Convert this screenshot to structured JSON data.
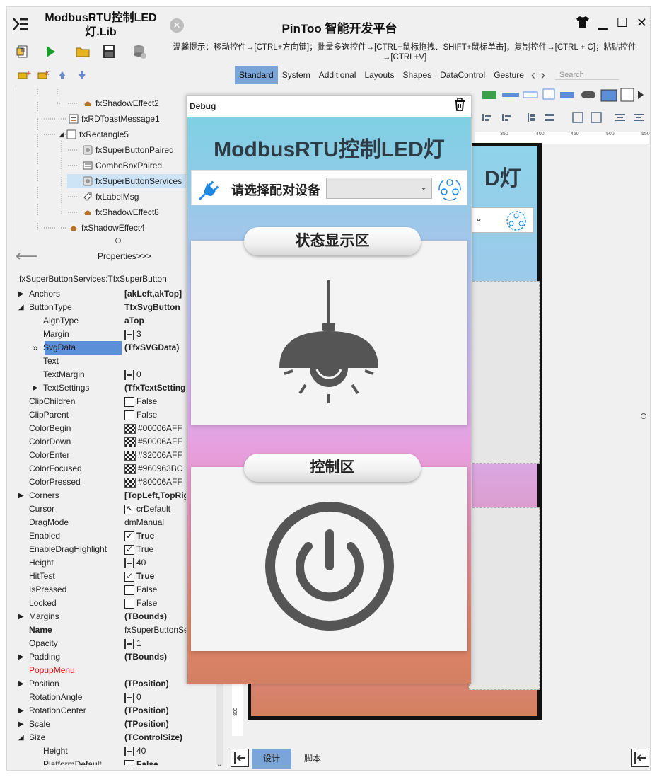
{
  "titlebar": {
    "doc_title": "ModbusRTU控制LED灯.Lib",
    "app_title": "PinToo 智能开发平台",
    "close_doc": "✕",
    "menu_icon": "menu-icon"
  },
  "toolbar": {
    "hint": "温馨提示：移动控件→[CTRL+方向键]；批量多选控件→[CTRL+鼠标拖拽、SHIFT+鼠标单击]；复制控件→[CTRL + C]；粘贴控件→[CTRL+V]"
  },
  "tree": {
    "items": [
      {
        "label": "fxShadowEffect2",
        "icon": "shadow-effect-icon"
      },
      {
        "label": "fxRDToastMessage1",
        "icon": "toast-icon"
      },
      {
        "label": "fxRectangle5",
        "icon": "rectangle-icon"
      },
      {
        "label": "fxSuperButtonPaired",
        "icon": "super-button-icon"
      },
      {
        "label": "ComboBoxPaired",
        "icon": "combobox-icon"
      },
      {
        "label": "fxSuperButtonServices",
        "icon": "super-button-icon"
      },
      {
        "label": "fxLabelMsg",
        "icon": "label-icon"
      },
      {
        "label": "fxShadowEffect8",
        "icon": "shadow-effect-icon"
      },
      {
        "label": "fxShadowEffect4",
        "icon": "shadow-effect-icon"
      }
    ]
  },
  "props_nav": {
    "link": "Properties>>>",
    "component": "fxSuperButtonServices:TfxSuperButton"
  },
  "properties": [
    {
      "k": "Anchors",
      "v": "[akLeft,akTop]",
      "arrow": "▶",
      "bold_v": true,
      "indent": 0
    },
    {
      "k": "ButtonType",
      "v": "TfxSvgButton",
      "arrow": "◢",
      "bold_v": true,
      "indent": 0
    },
    {
      "k": "AlgnType",
      "v": "aTop",
      "arrow": "",
      "bold_v": true,
      "indent": 1
    },
    {
      "k": "Margin",
      "v": "3",
      "arrow": "",
      "bold_v": false,
      "indent": 1,
      "icon": "ibeam"
    },
    {
      "k": "SvgData",
      "v": "(TfxSVGData)",
      "arrow": "»",
      "bold_v": true,
      "indent": 1,
      "selected": true
    },
    {
      "k": "Text",
      "v": "",
      "arrow": "",
      "bold_v": false,
      "indent": 1
    },
    {
      "k": "TextMargin",
      "v": "0",
      "arrow": "",
      "bold_v": false,
      "indent": 1,
      "icon": "ibeam"
    },
    {
      "k": "TextSettings",
      "v": "(TfxTextSetting",
      "arrow": "▶",
      "bold_v": true,
      "indent": 1
    },
    {
      "k": "ClipChildren",
      "v": "False",
      "arrow": "",
      "bold_v": false,
      "indent": 0,
      "icon": "check-off"
    },
    {
      "k": "ClipParent",
      "v": "False",
      "arrow": "",
      "bold_v": false,
      "indent": 0,
      "icon": "check-off"
    },
    {
      "k": "ColorBegin",
      "v": "#00006AFF",
      "arrow": "",
      "bold_v": false,
      "indent": 0,
      "icon": "swatch"
    },
    {
      "k": "ColorDown",
      "v": "#50006AFF",
      "arrow": "",
      "bold_v": false,
      "indent": 0,
      "icon": "swatch"
    },
    {
      "k": "ColorEnter",
      "v": "#32006AFF",
      "arrow": "",
      "bold_v": false,
      "indent": 0,
      "icon": "swatch"
    },
    {
      "k": "ColorFocused",
      "v": "#960963BC",
      "arrow": "",
      "bold_v": false,
      "indent": 0,
      "icon": "swatch"
    },
    {
      "k": "ColorPressed",
      "v": "#80006AFF",
      "arrow": "",
      "bold_v": false,
      "indent": 0,
      "icon": "swatch"
    },
    {
      "k": "Corners",
      "v": "[TopLeft,TopRig",
      "arrow": "▶",
      "bold_v": true,
      "indent": 0
    },
    {
      "k": "Cursor",
      "v": "crDefault",
      "arrow": "",
      "bold_v": false,
      "indent": 0,
      "icon": "cursor"
    },
    {
      "k": "DragMode",
      "v": "dmManual",
      "arrow": "",
      "bold_v": false,
      "indent": 0
    },
    {
      "k": "Enabled",
      "v": "True",
      "arrow": "",
      "bold_v": true,
      "indent": 0,
      "icon": "check-on"
    },
    {
      "k": "EnableDragHighlight",
      "v": "True",
      "arrow": "",
      "bold_v": false,
      "indent": 0,
      "icon": "check-on"
    },
    {
      "k": "Height",
      "v": "40",
      "arrow": "",
      "bold_v": false,
      "indent": 0,
      "icon": "ibeam"
    },
    {
      "k": "HitTest",
      "v": "True",
      "arrow": "",
      "bold_v": true,
      "indent": 0,
      "icon": "check-on"
    },
    {
      "k": "IsPressed",
      "v": "False",
      "arrow": "",
      "bold_v": false,
      "indent": 0,
      "icon": "check-off"
    },
    {
      "k": "Locked",
      "v": "False",
      "arrow": "",
      "bold_v": false,
      "indent": 0,
      "icon": "check-off"
    },
    {
      "k": "Margins",
      "v": "(TBounds)",
      "arrow": "▶",
      "bold_v": true,
      "indent": 0
    },
    {
      "k": "Name",
      "v": "fxSuperButtonSe",
      "arrow": "",
      "bold_v": false,
      "indent": 0,
      "bold_k": true
    },
    {
      "k": "Opacity",
      "v": "1",
      "arrow": "",
      "bold_v": false,
      "indent": 0,
      "icon": "ibeam"
    },
    {
      "k": "Padding",
      "v": "(TBounds)",
      "arrow": "▶",
      "bold_v": true,
      "indent": 0
    },
    {
      "k": "PopupMenu",
      "v": "",
      "arrow": "",
      "bold_v": false,
      "indent": 0,
      "red_k": true
    },
    {
      "k": "Position",
      "v": "(TPosition)",
      "arrow": "▶",
      "bold_v": true,
      "indent": 0
    },
    {
      "k": "RotationAngle",
      "v": "0",
      "arrow": "",
      "bold_v": false,
      "indent": 0,
      "icon": "ibeam"
    },
    {
      "k": "RotationCenter",
      "v": "(TPosition)",
      "arrow": "▶",
      "bold_v": true,
      "indent": 0
    },
    {
      "k": "Scale",
      "v": "(TPosition)",
      "arrow": "▶",
      "bold_v": true,
      "indent": 0
    },
    {
      "k": "Size",
      "v": "(TControlSize)",
      "arrow": "◢",
      "bold_v": true,
      "indent": 0
    },
    {
      "k": "Height",
      "v": "40",
      "arrow": "",
      "bold_v": false,
      "indent": 1,
      "icon": "ibeam"
    },
    {
      "k": "PlatformDefault",
      "v": "False",
      "arrow": "",
      "bold_v": true,
      "indent": 1,
      "icon": "check-off"
    }
  ],
  "palette": {
    "tabs": [
      "Standard",
      "System",
      "Additional",
      "Layouts",
      "Shapes",
      "DataControl",
      "Gesture"
    ],
    "active_tab": "Standard",
    "search_placeholder": "Search"
  },
  "ruler": {
    "ticks": [
      "350",
      "400",
      "450",
      "500",
      "550"
    ],
    "vtick": "800"
  },
  "bottom": {
    "design_tab": "设计",
    "script_tab": "脚本"
  },
  "debug": {
    "title": "Debug",
    "heading": "ModbusRTU控制LED灯",
    "pair_label": "请选择配对设备",
    "combo_value": "",
    "status_title": "状态显示区",
    "control_title": "控制区"
  },
  "canvas": {
    "heading_fragment": "D灯"
  },
  "colors": {
    "accent_tab": "#7aa5d8",
    "icon_gray": "#555555",
    "plug_blue": "#1e88e5",
    "heading": "#2e3b45"
  }
}
